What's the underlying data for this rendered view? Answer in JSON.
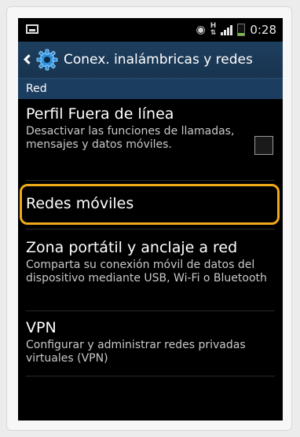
{
  "status_bar": {
    "time": "0:28",
    "network_type": "H",
    "icons": [
      "screenshot-icon",
      "eye-icon",
      "hplus-icon",
      "signal-icon",
      "battery-icon"
    ]
  },
  "action_bar": {
    "title": "Conex. inalámbricas y redes",
    "back_icon": "chevron-left-icon",
    "app_icon": "gear-icon"
  },
  "section": {
    "header": "Red"
  },
  "settings": [
    {
      "title": "Perfil Fuera de línea",
      "description": "Desactivar las funciones de llamadas, mensajes y datos móviles.",
      "checked": false
    },
    {
      "title": "Redes móviles",
      "highlighted": true
    },
    {
      "title": "Zona portátil y anclaje a red",
      "description": "Comparta su conexión móvil de datos del dispositivo mediante USB, Wi-Fi o Bluetooth"
    },
    {
      "title": "VPN",
      "description": "Configurar y administrar redes privadas virtuales (VPN)"
    }
  ],
  "colors": {
    "action_bar": "#1f3f5f",
    "section_header": "#1b3d60",
    "highlight": "#f0a91a",
    "background": "#000000"
  }
}
